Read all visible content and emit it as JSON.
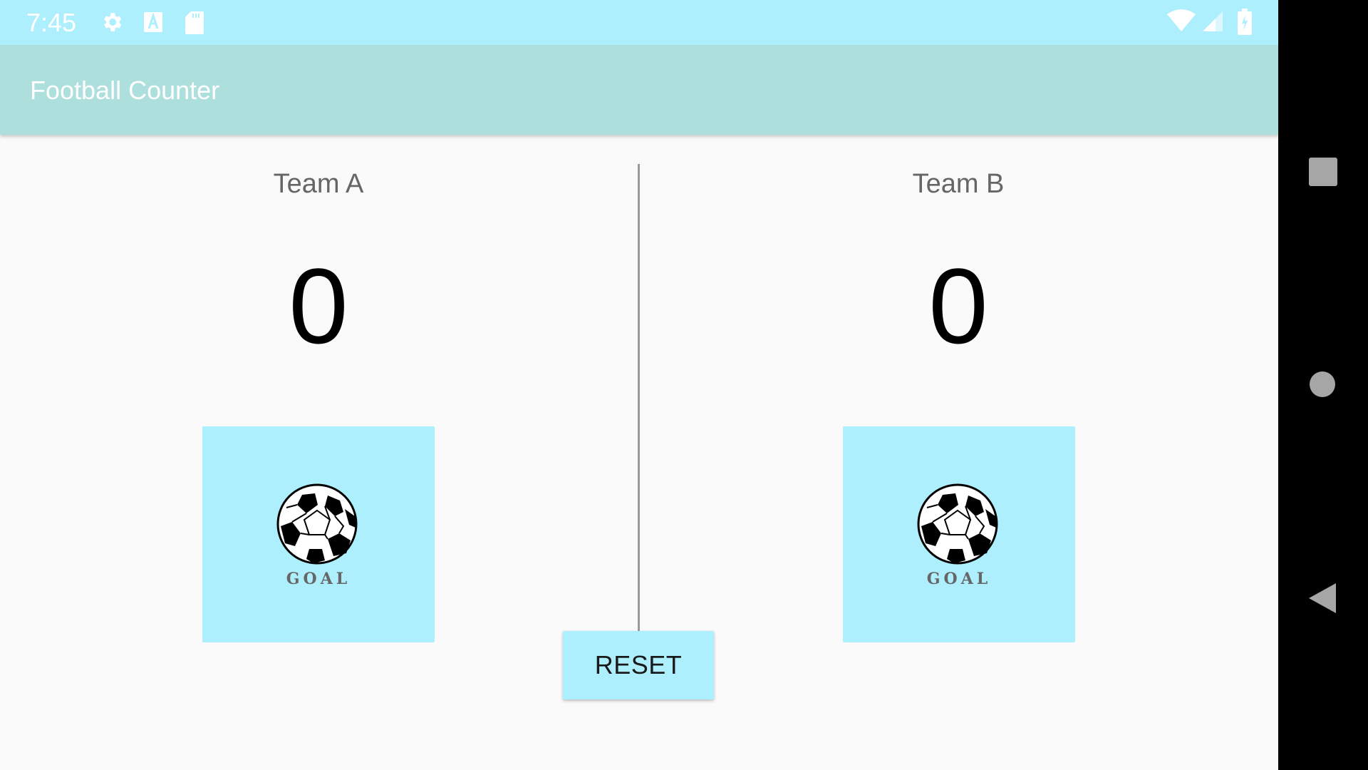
{
  "status_bar": {
    "time": "7:45",
    "icons": [
      "gear-icon",
      "font-a-icon",
      "sd-card-icon",
      "wifi-icon",
      "cell-signal-icon",
      "battery-charging-icon"
    ]
  },
  "app_bar": {
    "title": "Football Counter",
    "color": "#addfdd"
  },
  "teams": [
    {
      "name": "Team A",
      "score": "0",
      "goal_label": "GOAL"
    },
    {
      "name": "Team B",
      "score": "0",
      "goal_label": "GOAL"
    }
  ],
  "reset_label": "RESET",
  "colors": {
    "accent": "#aeeffd",
    "status_bar": "#aeeffd",
    "background": "#fafafa",
    "divider": "#9a9a9a"
  },
  "nav_bar": {
    "icons": [
      "recents-square-icon",
      "home-circle-icon",
      "back-triangle-icon"
    ]
  }
}
